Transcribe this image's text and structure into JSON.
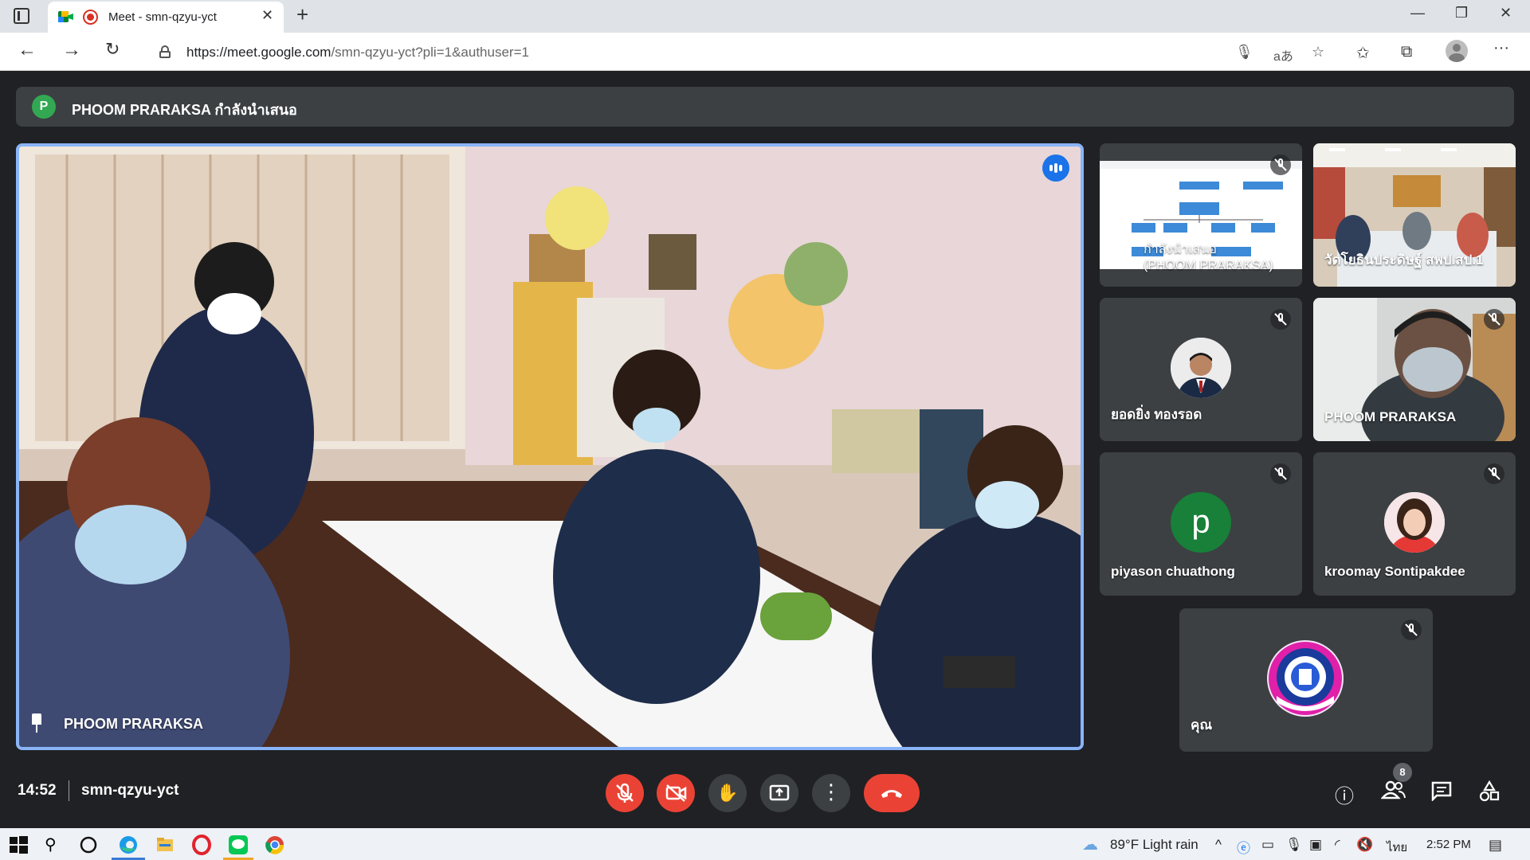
{
  "browser": {
    "tab_title": "Meet - smn-qzyu-yct",
    "url_host": "https://meet.google.com",
    "url_path": "/smn-qzyu-yct?pli=1&authuser=1"
  },
  "meet": {
    "presenter_initial": "P",
    "presenting_text": "PHOOM PRARAKSA กำลังนำเสนอ",
    "main_speaker": "PHOOM PRARAKSA",
    "tiles": [
      {
        "name": "กำลังนำเสนอ\n(PHOOM PRARAKSA)",
        "muted": true
      },
      {
        "name": "วัดโยธินประดิษฐ์ สพป.สป.1",
        "muted": false
      },
      {
        "name": "ยอดยิ่ง ทองรอด",
        "muted": true
      },
      {
        "name": "PHOOM PRARAKSA",
        "muted": true
      },
      {
        "name": "piyason chuathong",
        "initial": "p",
        "muted": true
      },
      {
        "name": "kroomay Sontipakdee",
        "muted": true
      },
      {
        "name": "คุณ",
        "muted": true
      }
    ],
    "clock": "14:52",
    "meeting_code": "smn-qzyu-yct",
    "participant_count": "8"
  },
  "taskbar": {
    "weather": "89°F  Light rain",
    "language": "ไทย",
    "time": "2:52 PM"
  },
  "colors": {
    "accent": "#8ab4f8",
    "danger": "#ea4335",
    "surface": "#3c4043",
    "background": "#202124"
  }
}
